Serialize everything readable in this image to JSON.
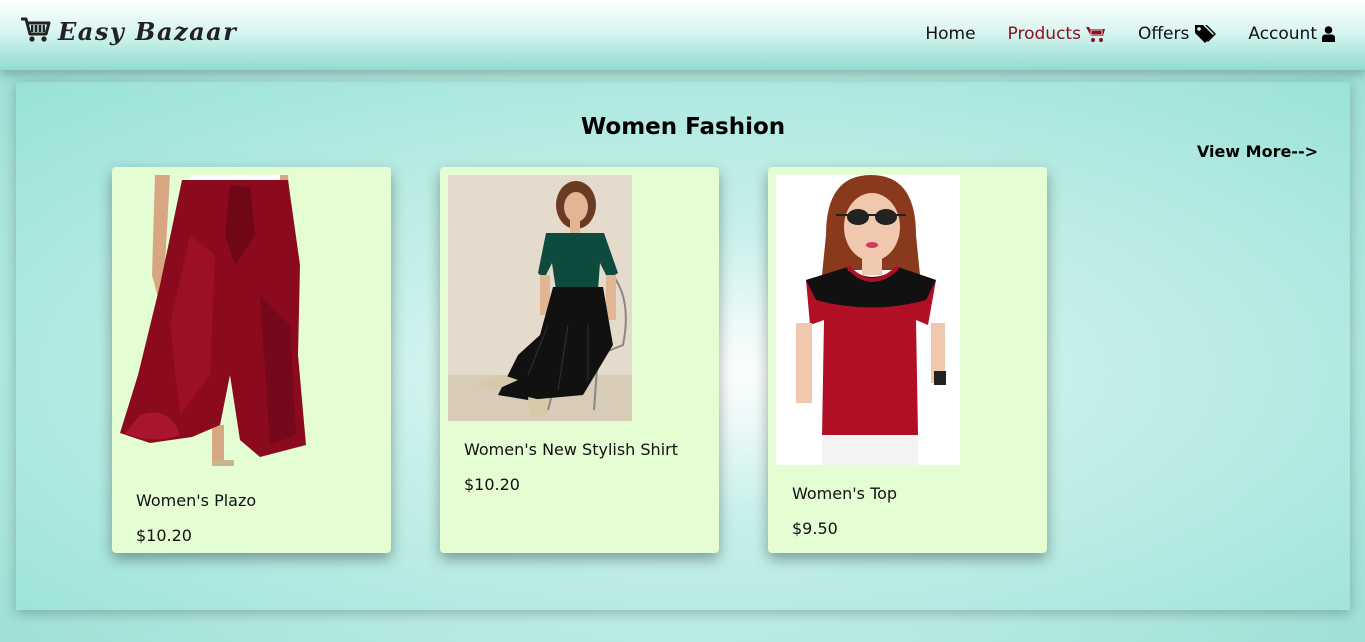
{
  "brand": {
    "name": "Easy Bazaar",
    "logo_icon": "shopping-cart-icon"
  },
  "nav": {
    "items": [
      {
        "label": "Home",
        "icon": null,
        "active": false
      },
      {
        "label": "Products",
        "icon": "cart-icon",
        "active": true
      },
      {
        "label": "Offers",
        "icon": "tags-icon",
        "active": false
      },
      {
        "label": "Account",
        "icon": "user-icon",
        "active": false
      }
    ]
  },
  "section": {
    "title": "Women Fashion",
    "view_more": "View More-->"
  },
  "products": [
    {
      "name": "Women's Plazo",
      "price": "$10.20",
      "image": "maroon ruffled palazzo pants"
    },
    {
      "name": "Women's New Stylish Shirt",
      "price": "$10.20",
      "image": "woman in green shirt and black pleated skirt seated"
    },
    {
      "name": "Women's Top",
      "price": "$9.50",
      "image": "woman in red top with black shoulders"
    }
  ],
  "colors": {
    "accent": "#8b1020",
    "card_bg": "#e4fdd3",
    "header_bg": "#8fdcd1"
  }
}
